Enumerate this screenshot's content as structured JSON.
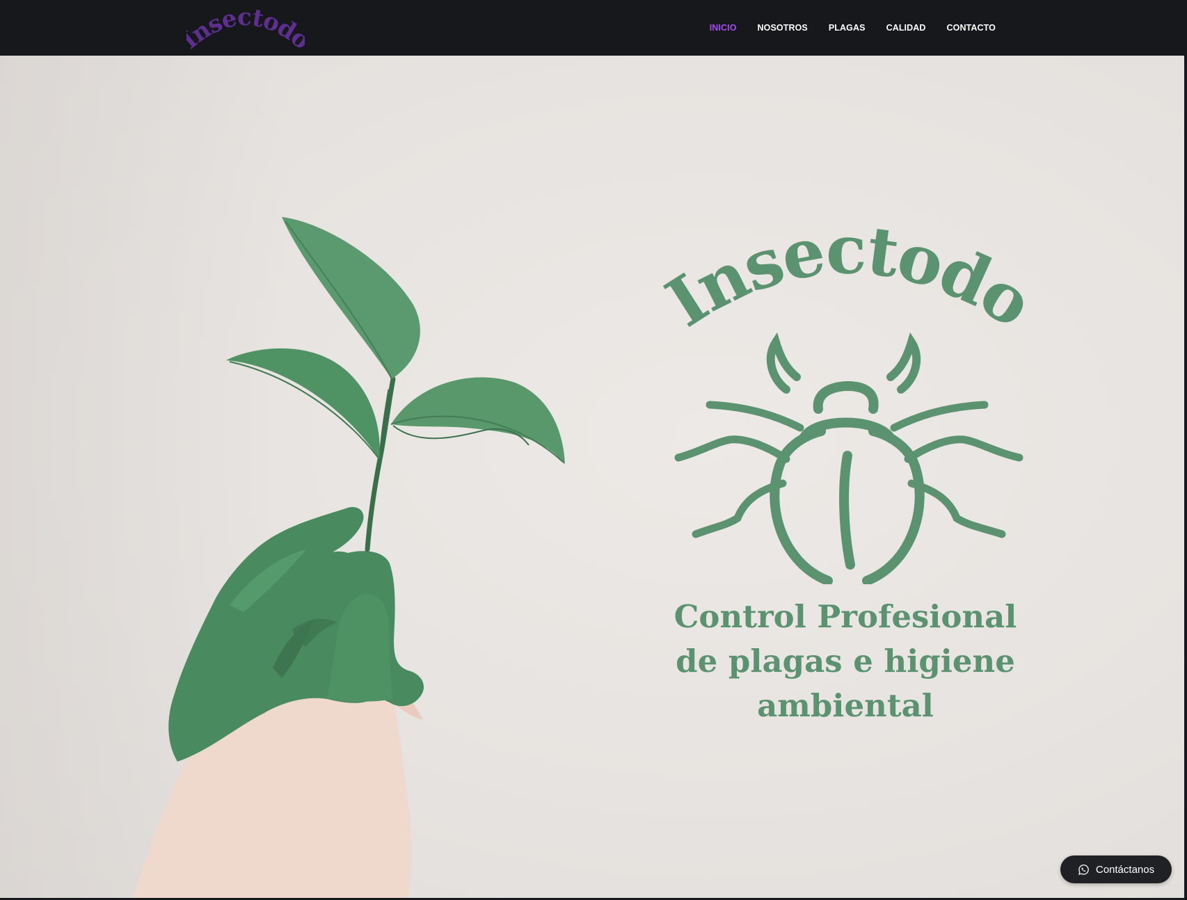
{
  "header": {
    "logo_text": "Insectodo",
    "nav": [
      {
        "label": "INICIO",
        "active": true
      },
      {
        "label": "NOSOTROS",
        "active": false
      },
      {
        "label": "PLAGAS",
        "active": false
      },
      {
        "label": "CALIDAD",
        "active": false
      },
      {
        "label": "CONTACTO",
        "active": false
      }
    ]
  },
  "hero": {
    "brand_name": "Insectodo",
    "tagline": "Control Profesional de plagas e higiene ambiental",
    "image": "hand-holding-plant",
    "emblem": "beetle-icon"
  },
  "floating_contact": {
    "label": "Contáctanos",
    "icon": "whatsapp-icon"
  },
  "colors": {
    "topbar": "#16181b",
    "active_nav": "#a34ee8",
    "logo_purple": "#5e2f91",
    "brand_green": "#5b9270",
    "background": "#e8e5e2"
  }
}
